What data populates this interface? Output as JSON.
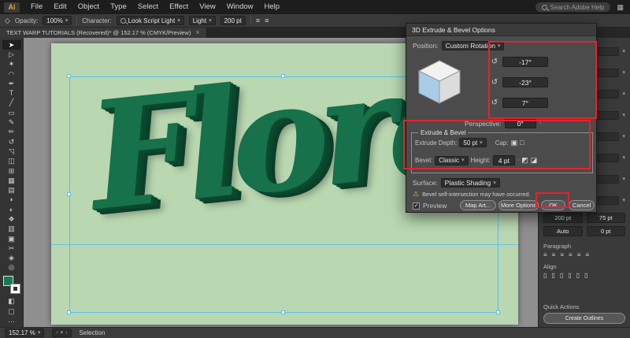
{
  "icons": {
    "chevron_down": "▾",
    "chevron_right": "›",
    "chevron_left": "‹",
    "close": "×",
    "check": "✓",
    "warning": "⚠",
    "rotate_axis": "↺",
    "cap_solid": "▣",
    "cap_open": "□",
    "bevel_out": "◩",
    "bevel_in": "◪",
    "align_lines": "≡",
    "align_objects": "▯",
    "object": "◇",
    "grid": "▦",
    "draw_mode": "◧",
    "screen_mode": "▢",
    "more": "⋯"
  },
  "menu_bar": {
    "logo": "Ai",
    "items": [
      "File",
      "Edit",
      "Object",
      "Type",
      "Select",
      "Effect",
      "View",
      "Window",
      "Help"
    ],
    "search_placeholder": "Search Adobe Help"
  },
  "options_bar": {
    "opacity_label": "Opacity:",
    "opacity_value": "100%",
    "character_label": "Character:",
    "font_value": "Look Script Light",
    "style_value": "Light",
    "size_value": "200 pt"
  },
  "tab": {
    "title": "TEXT WARP TUTORIALS (Recovered)* @ 152.17 % (CMYK/Preview)"
  },
  "toolbar": {
    "tools": [
      {
        "name": "selection-tool",
        "glyph": "➤"
      },
      {
        "name": "direct-selection-tool",
        "glyph": "▷"
      },
      {
        "name": "magic-wand-tool",
        "glyph": "✶"
      },
      {
        "name": "lasso-tool",
        "glyph": "◠"
      },
      {
        "name": "pen-tool",
        "glyph": "✒"
      },
      {
        "name": "type-tool",
        "glyph": "T"
      },
      {
        "name": "line-segment-tool",
        "glyph": "╱"
      },
      {
        "name": "rectangle-tool",
        "glyph": "▭"
      },
      {
        "name": "paintbrush-tool",
        "glyph": "✎"
      },
      {
        "name": "pencil-tool",
        "glyph": "✏"
      },
      {
        "name": "rotate-tool",
        "glyph": "↺"
      },
      {
        "name": "scale-tool",
        "glyph": "◹"
      },
      {
        "name": "shape-builder-tool",
        "glyph": "◫"
      },
      {
        "name": "perspective-grid-tool",
        "glyph": "⊞"
      },
      {
        "name": "mesh-tool",
        "glyph": "▦"
      },
      {
        "name": "gradient-tool",
        "glyph": "▤"
      },
      {
        "name": "eyedropper-tool",
        "glyph": "◗"
      },
      {
        "name": "blend-tool",
        "glyph": "◐"
      },
      {
        "name": "symbol-sprayer-tool",
        "glyph": "❖"
      },
      {
        "name": "column-graph-tool",
        "glyph": "▥"
      },
      {
        "name": "artboard-tool",
        "glyph": "▣"
      },
      {
        "name": "slice-tool",
        "glyph": "✂"
      },
      {
        "name": "hand-tool",
        "glyph": "◈"
      },
      {
        "name": "zoom-tool",
        "glyph": "◎"
      }
    ]
  },
  "canvas": {
    "artboard_text": "Flora"
  },
  "dialog": {
    "title": "3D Extrude & Bevel Options",
    "position_label": "Position:",
    "position_value": "Custom Rotation",
    "rotate_x": "-17°",
    "rotate_y": "-23°",
    "rotate_z": "7°",
    "perspective_label": "Perspective:",
    "perspective_value": "0°",
    "section_title": "Extrude & Bevel",
    "extrude_depth_label": "Extrude Depth:",
    "extrude_depth_value": "50 pt",
    "cap_label": "Cap:",
    "bevel_label": "Bevel:",
    "bevel_value": "Classic",
    "height_label": "Height:",
    "height_value": "4 pt",
    "surface_label": "Surface:",
    "surface_value": "Plastic Shading",
    "warning": "Bevel self-intersection may have occurred.",
    "preview_label": "Preview",
    "map_art_label": "Map Art...",
    "more_options_label": "More Options",
    "ok_label": "OK",
    "cancel_label": "Cancel"
  },
  "right_panel": {
    "size_value": "200 pt",
    "leading_value": "75 pt",
    "kerning_value": "Auto",
    "tracking_value": "0 pt",
    "paragraph_title": "Paragraph",
    "align_title": "Align",
    "quick_actions_title": "Quick Actions",
    "create_outlines_label": "Create Outlines"
  },
  "status_bar": {
    "zoom": "152.17 %",
    "tool": "Selection"
  },
  "colors": {
    "annotation": "#e4222c",
    "artboard": "#b9d7b1",
    "text_green": "#17714a"
  }
}
